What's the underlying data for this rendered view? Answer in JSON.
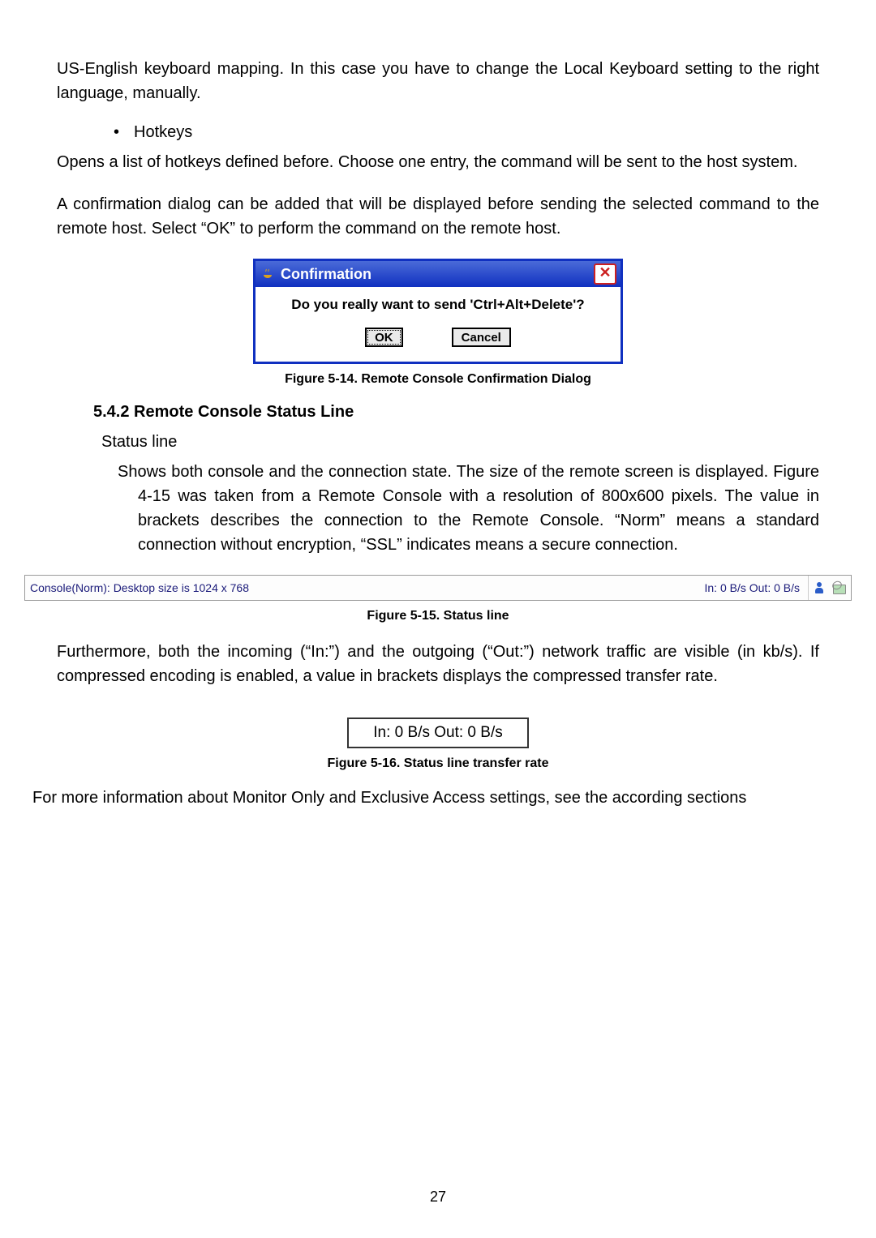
{
  "intro_para": "US-English keyboard mapping. In this case you have to change the Local Keyboard setting to the right language, manually.",
  "hotkeys_label": "Hotkeys",
  "hotkeys_para1": "Opens a list of hotkeys defined before. Choose one entry, the command will be sent to the host system.",
  "hotkeys_para2": "A confirmation dialog can be added that will be displayed before sending the selected command to the remote host. Select “OK” to perform the command on the remote host.",
  "dialog": {
    "title": "Confirmation",
    "message": "Do you really want to send 'Ctrl+Alt+Delete'?",
    "ok": "OK",
    "cancel": "Cancel"
  },
  "fig14_caption": "Figure 5-14. Remote Console Confirmation Dialog",
  "section_542": "5.4.2   Remote Console Status Line",
  "status_heading": "Status line",
  "status_para1": "Shows both console and the connection state. The size of the remote screen is displayed. Figure 4-15 was taken from a Remote Console with a resolution of 800x600 pixels. The value in brackets describes the connection to the Remote Console. “Norm” means a standard connection without encryption, “SSL” indicates means a secure connection.",
  "status_bar": {
    "left": "Console(Norm): Desktop size is 1024 x 768",
    "right": "In: 0 B/s Out: 0 B/s"
  },
  "fig15_caption": "Figure 5-15. Status line",
  "status_para2": "Furthermore, both the incoming (“In:”) and the outgoing (“Out:”) network traffic are visible (in kb/s). If compressed encoding is enabled, a value in brackets displays the compressed transfer rate.",
  "transfer_text": "In: 0 B/s Out: 0 B/s",
  "fig16_caption": "Figure 5-16. Status line transfer rate",
  "bottom_para": "For more information about Monitor Only and Exclusive Access settings, see the according sections",
  "page_number": "27"
}
